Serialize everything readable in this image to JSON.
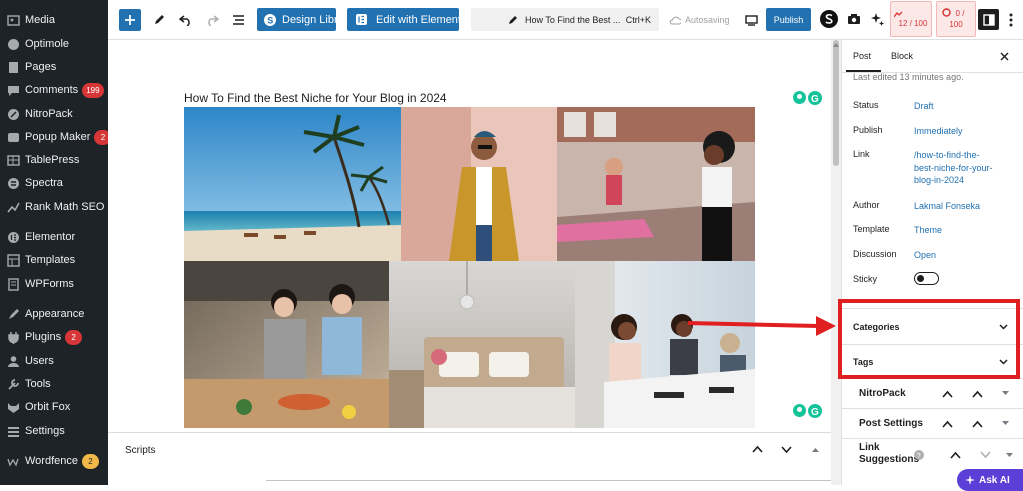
{
  "sidebar": {
    "items": [
      {
        "label": "Media",
        "icon": "media-icon"
      },
      {
        "label": "Optimole",
        "icon": "optimole-icon"
      },
      {
        "label": "Pages",
        "icon": "pages-icon"
      },
      {
        "label": "Comments",
        "icon": "comments-icon",
        "badge": "199"
      },
      {
        "label": "NitroPack",
        "icon": "nitropack-icon"
      },
      {
        "label": "Popup Maker",
        "icon": "popup-maker-icon",
        "badge": "2"
      },
      {
        "label": "TablePress",
        "icon": "tablepress-icon"
      },
      {
        "label": "Spectra",
        "icon": "spectra-icon"
      },
      {
        "label": "Rank Math SEO",
        "icon": "rank-math-icon"
      },
      {
        "label": "Elementor",
        "icon": "elementor-icon"
      },
      {
        "label": "Templates",
        "icon": "templates-icon"
      },
      {
        "label": "WPForms",
        "icon": "wpforms-icon"
      },
      {
        "label": "Appearance",
        "icon": "appearance-icon"
      },
      {
        "label": "Plugins",
        "icon": "plugins-icon",
        "badge": "2"
      },
      {
        "label": "Users",
        "icon": "users-icon"
      },
      {
        "label": "Tools",
        "icon": "tools-icon"
      },
      {
        "label": "Orbit Fox",
        "icon": "orbit-fox-icon"
      },
      {
        "label": "Settings",
        "icon": "settings-icon"
      },
      {
        "label": "Wordfence",
        "icon": "wordfence-icon",
        "badge": "2"
      }
    ]
  },
  "toolbar": {
    "design_library": "Design Library",
    "edit_elementor": "Edit with Elementor",
    "doc_title": "How To Find the Best ...",
    "shortcut": "Ctrl+K",
    "autosaving": "Autosaving",
    "publish": "Publish",
    "score1": "12 / 100",
    "score2_a": "0 /",
    "score2_b": "100"
  },
  "post": {
    "title": "How To Find the Best Niche for Your Blog in 2024"
  },
  "scripts_label": "Scripts",
  "settings": {
    "tab_post": "Post",
    "tab_block": "Block",
    "last_edited": "Last edited 13 minutes ago.",
    "status_label": "Status",
    "status_value": "Draft",
    "publish_label": "Publish",
    "publish_value": "Immediately",
    "link_label": "Link",
    "link_value_1": "/how-to-find-the-",
    "link_value_2": "best-niche-for-your-",
    "link_value_3": "blog-in-2024",
    "author_label": "Author",
    "author_value": "Lakmal Fonseka",
    "template_label": "Template",
    "template_value": "Theme",
    "discussion_label": "Discussion",
    "discussion_value": "Open",
    "sticky_label": "Sticky",
    "categories": "Categories",
    "tags": "Tags",
    "nitropack": "NitroPack",
    "post_settings": "Post Settings",
    "link_suggestions_1": "Link",
    "link_suggestions_2": "Suggestions",
    "ask_ai": "Ask AI"
  },
  "colors": {
    "accent": "#2271b1",
    "annotation": "#e02020",
    "admin_bg": "#1d2327"
  }
}
